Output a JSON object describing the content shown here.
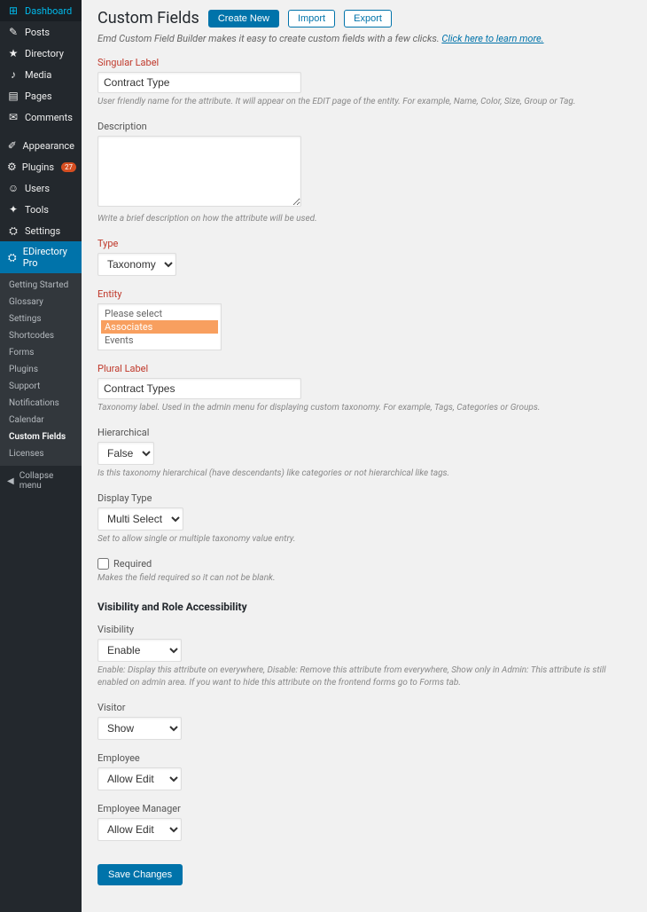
{
  "sidebar": {
    "items": [
      {
        "label": "Dashboard",
        "icon": "dashboard"
      },
      {
        "label": "Posts",
        "icon": "pin"
      },
      {
        "label": "Directory",
        "icon": "user"
      },
      {
        "label": "Media",
        "icon": "media"
      },
      {
        "label": "Pages",
        "icon": "page"
      },
      {
        "label": "Comments",
        "icon": "comment"
      },
      {
        "label": "Appearance",
        "icon": "brush"
      },
      {
        "label": "Plugins",
        "icon": "plug",
        "badge": "27"
      },
      {
        "label": "Users",
        "icon": "user"
      },
      {
        "label": "Tools",
        "icon": "tool"
      },
      {
        "label": "Settings",
        "icon": "gear"
      },
      {
        "label": "EDirectory Pro",
        "icon": "gear",
        "active": true
      }
    ],
    "submenu": [
      "Getting Started",
      "Glossary",
      "Settings",
      "Shortcodes",
      "Forms",
      "Plugins",
      "Support",
      "Notifications",
      "Calendar",
      "Custom Fields",
      "Licenses"
    ],
    "submenu_current": "Custom Fields",
    "collapse": "Collapse menu"
  },
  "header": {
    "title": "Custom Fields",
    "create": "Create New",
    "import": "Import",
    "export": "Export"
  },
  "intro": {
    "text": "Emd Custom Field Builder makes it easy to create custom fields with a few clicks. ",
    "link": "Click here to learn more."
  },
  "fields": {
    "singular": {
      "label": "Singular Label",
      "value": "Contract Type",
      "help": "User friendly name for the attribute. It will appear on the EDIT page of the entity. For example, Name, Color, Size, Group or Tag."
    },
    "description": {
      "label": "Description",
      "value": "",
      "help": "Write a brief description on how the attribute will be used."
    },
    "type": {
      "label": "Type",
      "value": "Taxonomy"
    },
    "entity": {
      "label": "Entity",
      "options": [
        "Please select",
        "Associates",
        "Events"
      ],
      "selected": "Associates"
    },
    "plural": {
      "label": "Plural Label",
      "value": "Contract Types",
      "help": "Taxonomy label. Used in the admin menu for displaying custom taxonomy. For example, Tags, Categories or Groups."
    },
    "hierarchical": {
      "label": "Hierarchical",
      "value": "False",
      "help": "Is this taxonomy hierarchical (have descendants) like categories or not hierarchical like tags."
    },
    "display_type": {
      "label": "Display Type",
      "value": "Multi Select",
      "help": "Set to allow single or multiple taxonomy value entry."
    },
    "required": {
      "label": "Required",
      "checked": false,
      "help": "Makes the field required so it can not be blank."
    }
  },
  "section2": {
    "title": "Visibility and Role Accessibility",
    "visibility": {
      "label": "Visibility",
      "value": "Enable",
      "help": "Enable: Display this attribute on everywhere, Disable: Remove this attribute from everywhere, Show only in Admin: This attribute is still enabled on admin area. If you want to hide this attribute on the frontend forms go to Forms tab."
    },
    "visitor": {
      "label": "Visitor",
      "value": "Show"
    },
    "employee": {
      "label": "Employee",
      "value": "Allow Edit"
    },
    "employee_manager": {
      "label": "Employee Manager",
      "value": "Allow Edit"
    }
  },
  "save": "Save Changes"
}
